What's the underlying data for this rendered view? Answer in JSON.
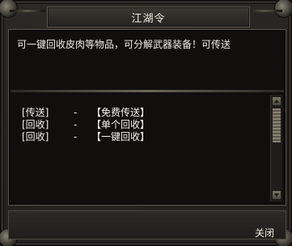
{
  "window": {
    "title": "江湖令"
  },
  "content": {
    "description": "可一键回收皮肉等物品，可分解武器装备！可传送",
    "options": [
      {
        "tag": "[传送]",
        "separator": "-",
        "action": "【免费传送】"
      },
      {
        "tag": "[回收]",
        "separator": "-",
        "action": "【单个回收】"
      },
      {
        "tag": "[回收]",
        "separator": "-",
        "action": "【一键回收】"
      }
    ]
  },
  "footer": {
    "close_label": "关闭"
  }
}
